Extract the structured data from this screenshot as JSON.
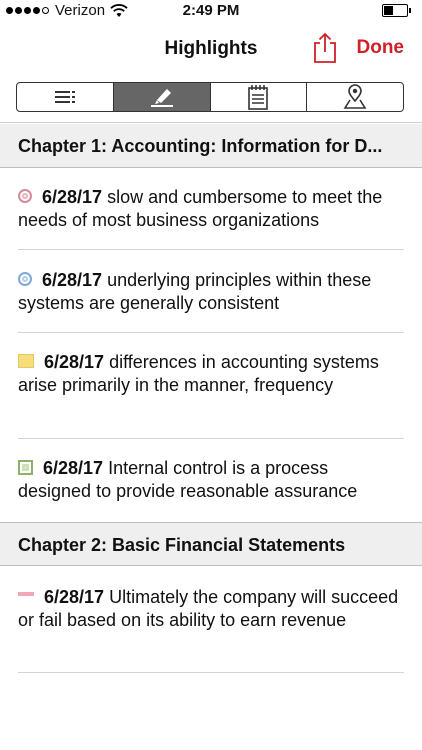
{
  "status": {
    "carrier": "Verizon",
    "time": "2:49 PM"
  },
  "nav": {
    "title": "Highlights",
    "done_label": "Done",
    "share_icon": "share-icon"
  },
  "segments": [
    {
      "icon": "list-icon",
      "active": false
    },
    {
      "icon": "highlighter-icon",
      "active": true
    },
    {
      "icon": "notepad-icon",
      "active": false
    },
    {
      "icon": "location-pin-icon",
      "active": false
    }
  ],
  "chapters": [
    {
      "title": "Chapter 1: Accounting: Information for D...",
      "entries": [
        {
          "marker": "red-circle",
          "date": "6/28/17",
          "text": "slow and cumbersome to meet the needs of most business organizations"
        },
        {
          "marker": "blue-circle",
          "date": "6/28/17",
          "text": "underlying principles within these systems are generally consistent"
        },
        {
          "marker": "yellow-square",
          "date": "6/28/17",
          "text": "differences in accounting systems arise primarily in the manner, frequency"
        },
        {
          "marker": "green-square",
          "date": "6/28/17",
          "text": "Internal control is a process designed to provide reasonable assurance"
        }
      ]
    },
    {
      "title": "Chapter 2: Basic Financial Statements",
      "entries": [
        {
          "marker": "pink-underline",
          "date": "6/28/17",
          "text": "Ultimately the company will succeed or fail based on its ability to earn revenue"
        }
      ]
    }
  ],
  "colors": {
    "accent": "#d0202a",
    "segment_active": "#666666",
    "chapter_bg": "#efefef"
  }
}
